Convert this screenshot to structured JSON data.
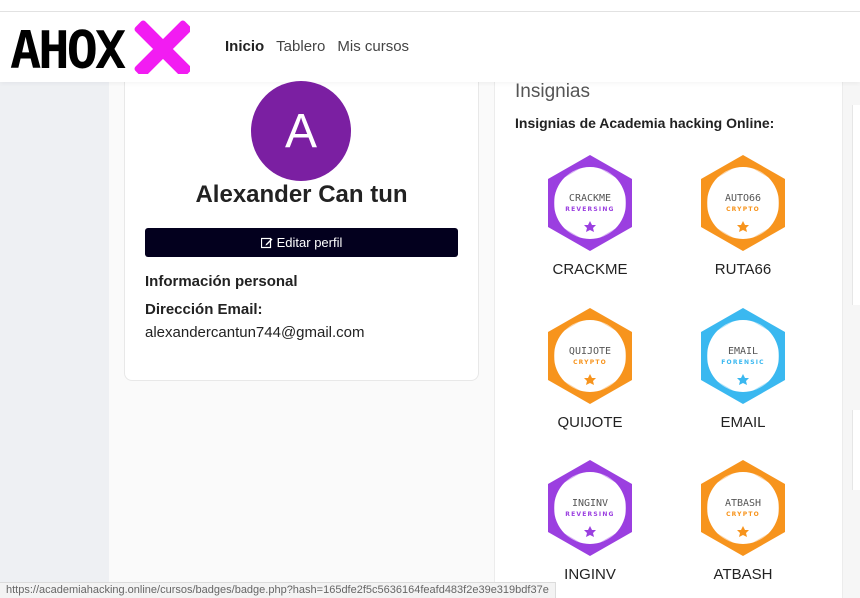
{
  "nav": {
    "brand": "AHOX",
    "links": [
      {
        "label": "Inicio",
        "active": true
      },
      {
        "label": "Tablero",
        "active": false
      },
      {
        "label": "Mis cursos",
        "active": false
      }
    ]
  },
  "profile": {
    "avatar_initial": "A",
    "name": "Alexander Can tun",
    "edit_label": "Editar perfil",
    "personal_info_title": "Información personal",
    "email_label": "Dirección Email:",
    "email_value": "alexandercantun744@gmail.com"
  },
  "badges": {
    "heading": "Insignias",
    "subheading": "Insignias de Academia hacking Online:",
    "items": [
      {
        "name": "CRACKME",
        "logo": "CRACKME",
        "category": "REVERSING",
        "color": "#9b3fe0"
      },
      {
        "name": "RUTA66",
        "logo": "AUTO66",
        "category": "CRYPTO",
        "color": "#f7941d"
      },
      {
        "name": "QUIJOTE",
        "logo": "QUIJOTE",
        "category": "CRYPTO",
        "color": "#f7941d"
      },
      {
        "name": "EMAIL",
        "logo": "EMAIL",
        "category": "FORENSIC",
        "color": "#3ab8f0"
      },
      {
        "name": "INGINV",
        "logo": "INGINV",
        "category": "REVERSING",
        "color": "#9b3fe0"
      },
      {
        "name": "ATBASH",
        "logo": "ATBASH",
        "category": "CRYPTO",
        "color": "#f7941d"
      }
    ]
  },
  "status_bar": {
    "url": "https://academiahacking.online/cursos/badges/badge.php?hash=165dfe2f5c5636164feafd483f2e39e319bdf37e"
  }
}
